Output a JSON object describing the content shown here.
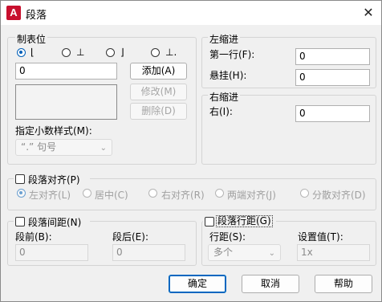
{
  "window": {
    "title": "段落",
    "app_icon_letter": "A"
  },
  "tab_stops": {
    "heading": "制表位",
    "value": "0",
    "add": "添加(A)",
    "modify": "修改(M)",
    "delete": "删除(D)",
    "decimal_style_label": "指定小数样式(M):",
    "decimal_style_value": "“.” 句号"
  },
  "left_indent": {
    "heading": "左缩进",
    "first_line_label": "第一行(F):",
    "first_line_value": "0",
    "hanging_label": "悬挂(H):",
    "hanging_value": "0"
  },
  "right_indent": {
    "heading": "右缩进",
    "right_label": "右(I):",
    "right_value": "0"
  },
  "alignment": {
    "checkbox_label": "段落对齐(P)",
    "options": [
      "左对齐(L)",
      "居中(C)",
      "右对齐(R)",
      "两端对齐(J)",
      "分散对齐(D)"
    ]
  },
  "spacing": {
    "checkbox_label": "段落间距(N)",
    "before_label": "段前(B):",
    "before_value": "0",
    "after_label": "段后(E):",
    "after_value": "0"
  },
  "line_spacing": {
    "checkbox_label": "段落行距(G)",
    "spacing_label": "行距(S):",
    "spacing_value": "多个",
    "setting_label": "设置值(T):",
    "setting_value": "1x"
  },
  "footer": {
    "ok": "确定",
    "cancel": "取消",
    "help": "帮助"
  },
  "colors": {
    "accent": "#005fb8",
    "app_icon": "#c8102e"
  }
}
